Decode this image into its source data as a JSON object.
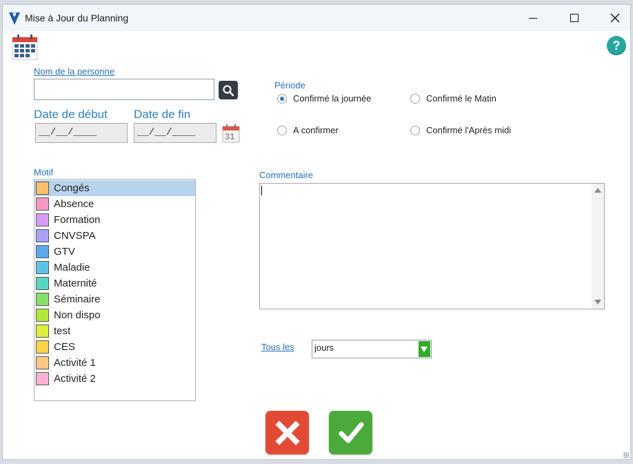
{
  "window": {
    "title": "Mise à Jour du Planning"
  },
  "form": {
    "person_label": "Nom de la personne",
    "person_value": "",
    "start_label": "Date de début",
    "start_value": "__/__/____",
    "end_label": "Date de fin",
    "end_value": "__/__/____",
    "calendar_day": "31"
  },
  "periode": {
    "label": "Période",
    "options": [
      {
        "label": "Confirmé la journée",
        "checked": true
      },
      {
        "label": "Confirmé le Matin",
        "checked": false
      },
      {
        "label": "A confirmer",
        "checked": false
      },
      {
        "label": "Confirmé l'Après midi",
        "checked": false
      }
    ]
  },
  "motif": {
    "label": "Motif",
    "items": [
      {
        "label": "Congés",
        "color": "#ffbf6b",
        "selected": true
      },
      {
        "label": "Absence",
        "color": "#f79ac0",
        "selected": false
      },
      {
        "label": "Formation",
        "color": "#d79cf2",
        "selected": false
      },
      {
        "label": "CNVSPA",
        "color": "#a9a3f5",
        "selected": false
      },
      {
        "label": "GTV",
        "color": "#5ea9ea",
        "selected": false
      },
      {
        "label": "Maladie",
        "color": "#5fc3e8",
        "selected": false
      },
      {
        "label": "Maternité",
        "color": "#58d6c4",
        "selected": false
      },
      {
        "label": "Séminaire",
        "color": "#86e06a",
        "selected": false
      },
      {
        "label": "Non dispo",
        "color": "#b4e83a",
        "selected": false
      },
      {
        "label": "test",
        "color": "#dcef3c",
        "selected": false
      },
      {
        "label": "CES",
        "color": "#ffd34a",
        "selected": false
      },
      {
        "label": "Activité 1",
        "color": "#ffc583",
        "selected": false
      },
      {
        "label": "Activité 2",
        "color": "#f9b3d1",
        "selected": false
      }
    ]
  },
  "comment": {
    "label": "Commentaire",
    "value": ""
  },
  "recurrence": {
    "label": "Tous les",
    "selected": "jours"
  },
  "help_glyph": "?"
}
